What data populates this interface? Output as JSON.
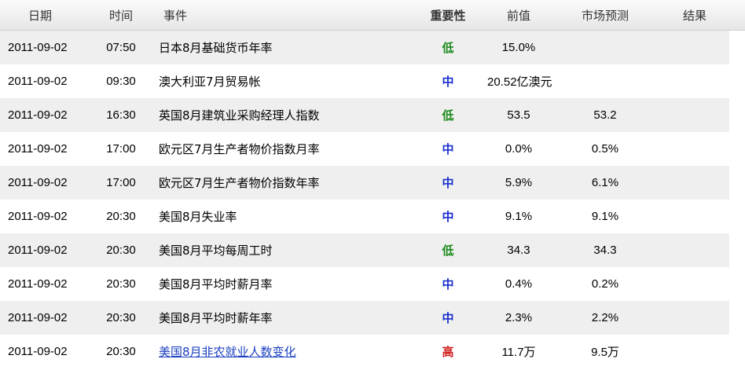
{
  "header": {
    "date": "日期",
    "time": "时间",
    "event": "事件",
    "importance": "重要性",
    "previous": "前值",
    "forecast": "市场预测",
    "result": "结果"
  },
  "colors": {
    "low": "#1a8a1a",
    "mid": "#1a2fd0",
    "high": "#d01a1a",
    "link": "#1a3fc0"
  },
  "rows": [
    {
      "date": "2011-09-02",
      "time": "07:50",
      "event": "日本8月基础货币年率",
      "importance": "低",
      "level": "low",
      "previous": "15.0%",
      "forecast": "",
      "result": ""
    },
    {
      "date": "2011-09-02",
      "time": "09:30",
      "event": "澳大利亚7月贸易帐",
      "importance": "中",
      "level": "mid",
      "previous": "20.52亿澳元",
      "forecast": "",
      "result": ""
    },
    {
      "date": "2011-09-02",
      "time": "16:30",
      "event": "英国8月建筑业采购经理人指数",
      "importance": "低",
      "level": "low",
      "previous": "53.5",
      "forecast": "53.2",
      "result": ""
    },
    {
      "date": "2011-09-02",
      "time": "17:00",
      "event": "欧元区7月生产者物价指数月率",
      "importance": "中",
      "level": "mid",
      "previous": "0.0%",
      "forecast": "0.5%",
      "result": ""
    },
    {
      "date": "2011-09-02",
      "time": "17:00",
      "event": "欧元区7月生产者物价指数年率",
      "importance": "中",
      "level": "mid",
      "previous": "5.9%",
      "forecast": "6.1%",
      "result": ""
    },
    {
      "date": "2011-09-02",
      "time": "20:30",
      "event": "美国8月失业率",
      "importance": "中",
      "level": "mid",
      "previous": "9.1%",
      "forecast": "9.1%",
      "result": ""
    },
    {
      "date": "2011-09-02",
      "time": "20:30",
      "event": "美国8月平均每周工时",
      "importance": "低",
      "level": "low",
      "previous": "34.3",
      "forecast": "34.3",
      "result": ""
    },
    {
      "date": "2011-09-02",
      "time": "20:30",
      "event": "美国8月平均时薪月率",
      "importance": "中",
      "level": "mid",
      "previous": "0.4%",
      "forecast": "0.2%",
      "result": ""
    },
    {
      "date": "2011-09-02",
      "time": "20:30",
      "event": "美国8月平均时薪年率",
      "importance": "中",
      "level": "mid",
      "previous": "2.3%",
      "forecast": "2.2%",
      "result": ""
    },
    {
      "date": "2011-09-02",
      "time": "20:30",
      "event": "美国8月非农就业人数变化",
      "importance": "高",
      "level": "high",
      "previous": "11.7万",
      "forecast": "9.5万",
      "result": "",
      "is_link": true
    }
  ]
}
